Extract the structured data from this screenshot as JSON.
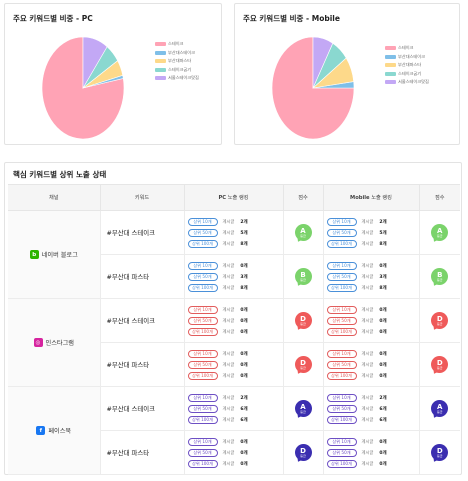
{
  "pc_card": {
    "title": "주요 키워드별 비중 - PC",
    "legend": [
      "스테이크",
      "부산대스테이크",
      "부산대파스타",
      "스테이크굽기",
      "서울스테이크맛집"
    ]
  },
  "mobile_card": {
    "title": "주요 키워드별 비중 - Mobile",
    "legend": [
      "스테이크",
      "부산대스테이크",
      "부산대파스타",
      "스테이크굽기",
      "서울스테이크맛집"
    ]
  },
  "colors": {
    "pie": [
      "#ffa3b5",
      "#7fbfe8",
      "#fdd98a",
      "#8ad8d0",
      "#c3a8f5"
    ],
    "score_green": "#7bd36b",
    "score_red": "#ef5a5a",
    "score_navy": "#3b2eb0",
    "pill_blue": "#4a90d9",
    "pill_red": "#e25c5c",
    "pill_purple": "#6d4fc4"
  },
  "chart_data": [
    {
      "type": "pie",
      "title": "주요 키워드별 비중 - PC",
      "labels": [
        "스테이크",
        "부산대스테이크",
        "부산대파스타",
        "스테이크굽기",
        "서울스테이크맛집"
      ],
      "values": [
        78,
        1,
        5,
        6,
        10
      ],
      "legend_position": "right"
    },
    {
      "type": "pie",
      "title": "주요 키워드별 비중 - Mobile",
      "labels": [
        "스테이크",
        "부산대스테이크",
        "부산대파스타",
        "스테이크굽기",
        "서울스테이크맛집"
      ],
      "values": [
        75,
        2,
        8,
        7,
        8
      ],
      "legend_position": "right"
    }
  ],
  "table": {
    "title": "핵심 키워드별 상위 노출 상태",
    "headers": {
      "channel": "채널",
      "keyword": "키워드",
      "pc_rank_bold": "PC",
      "pc_rank_rest": " 노출 랭킹",
      "pc_score": "점수",
      "mo_rank_bold": "Mobile",
      "mo_rank_rest": " 노출 랭킹",
      "mo_score": "점수"
    },
    "rank_labels": [
      "상위 10개",
      "상위 50개",
      "상위 100개"
    ],
    "post_label": "게시글",
    "score_sub": "등급",
    "channels": [
      {
        "name": "네이버 블로그",
        "icon": "naver-blog-icon",
        "icon_color": "#2db400",
        "icon_glyph": "b",
        "pill": "blue",
        "rows": [
          {
            "keyword": "#부산대 스테이크",
            "pc": [
              "2개",
              "5개",
              "8개"
            ],
            "pc_grade": "A",
            "mo": [
              "2개",
              "5개",
              "8개"
            ],
            "mo_grade": "A",
            "grade_color": "green"
          },
          {
            "keyword": "#부산대 파스타",
            "pc": [
              "0개",
              "3개",
              "8개"
            ],
            "pc_grade": "B",
            "mo": [
              "0개",
              "3개",
              "8개"
            ],
            "mo_grade": "B",
            "grade_color": "green"
          }
        ]
      },
      {
        "name": "인스타그램",
        "icon": "instagram-icon",
        "icon_color": "#d6249f",
        "icon_glyph": "◎",
        "pill": "red",
        "rows": [
          {
            "keyword": "#부산대 스테이크",
            "pc": [
              "0개",
              "0개",
              "0개"
            ],
            "pc_grade": "D",
            "mo": [
              "0개",
              "0개",
              "0개"
            ],
            "mo_grade": "D",
            "grade_color": "red"
          },
          {
            "keyword": "#부산대 파스타",
            "pc": [
              "0개",
              "0개",
              "0개"
            ],
            "pc_grade": "D",
            "mo": [
              "0개",
              "0개",
              "0개"
            ],
            "mo_grade": "D",
            "grade_color": "red"
          }
        ]
      },
      {
        "name": "페이스북",
        "icon": "facebook-icon",
        "icon_color": "#1877f2",
        "icon_glyph": "f",
        "pill": "purple",
        "rows": [
          {
            "keyword": "#부산대 스테이크",
            "pc": [
              "2개",
              "6개",
              "6개"
            ],
            "pc_grade": "A",
            "mo": [
              "2개",
              "6개",
              "6개"
            ],
            "mo_grade": "A",
            "grade_color": "navy"
          },
          {
            "keyword": "#부산대 파스타",
            "pc": [
              "0개",
              "0개",
              "0개"
            ],
            "pc_grade": "D",
            "mo": [
              "0개",
              "0개",
              "0개"
            ],
            "mo_grade": "D",
            "grade_color": "navy"
          }
        ]
      }
    ]
  }
}
